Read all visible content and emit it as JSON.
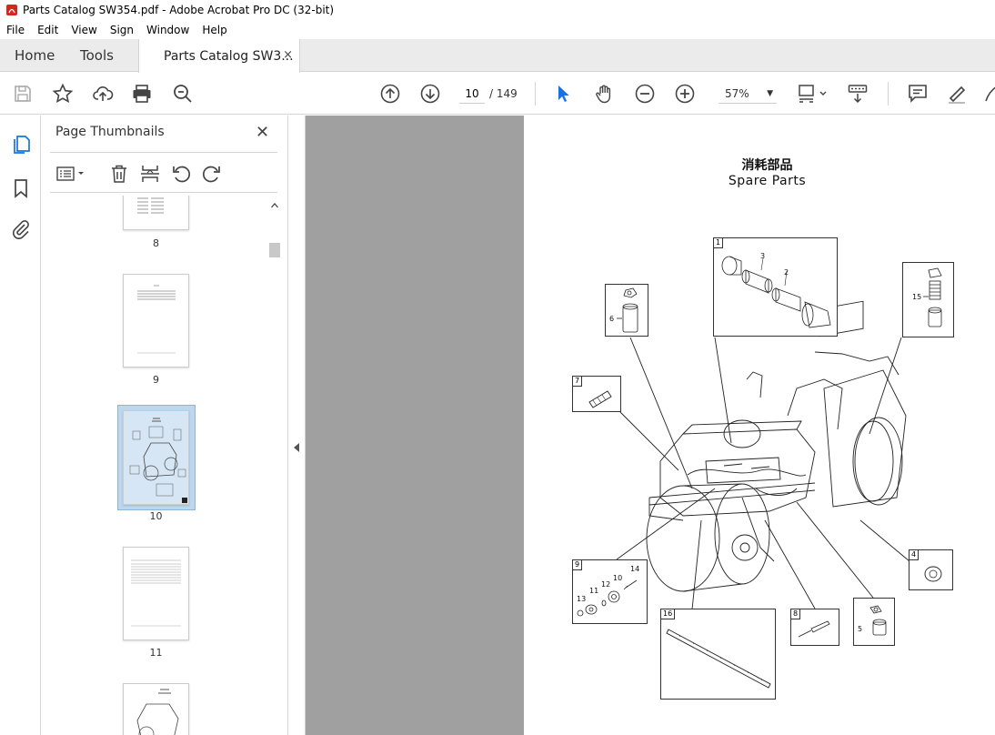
{
  "window": {
    "title": "Parts Catalog SW354.pdf - Adobe Acrobat Pro DC (32-bit)"
  },
  "menu": [
    "File",
    "Edit",
    "View",
    "Sign",
    "Window",
    "Help"
  ],
  "tabs": {
    "home": "Home",
    "tools": "Tools",
    "doc": "Parts Catalog SW3...",
    "close": "×"
  },
  "toolbar": {
    "page_current": "10",
    "page_total": "/ 149",
    "zoom": "57%"
  },
  "panel": {
    "title": "Page Thumbnails",
    "close": "✕",
    "thumbnails": [
      {
        "label": "8"
      },
      {
        "label": "9"
      },
      {
        "label": "10",
        "selected": true
      },
      {
        "label": "11"
      }
    ]
  },
  "page": {
    "title_jp": "消耗部品",
    "title_en": "Spare Parts",
    "callouts": [
      {
        "num": "1",
        "items": [
          "3",
          "2"
        ]
      },
      {
        "num": "6"
      },
      {
        "num": "15"
      },
      {
        "num": "7"
      },
      {
        "num": "4"
      },
      {
        "num": "9",
        "items": [
          "14",
          "10",
          "12",
          "11",
          "13"
        ]
      },
      {
        "num": "8"
      },
      {
        "num": "5"
      },
      {
        "num": "16"
      }
    ]
  },
  "colors": {
    "accent": "#1473e6",
    "tabbar": "#ebebeb",
    "canvas": "#a0a0a0",
    "pdf_red": "#d7261e"
  }
}
